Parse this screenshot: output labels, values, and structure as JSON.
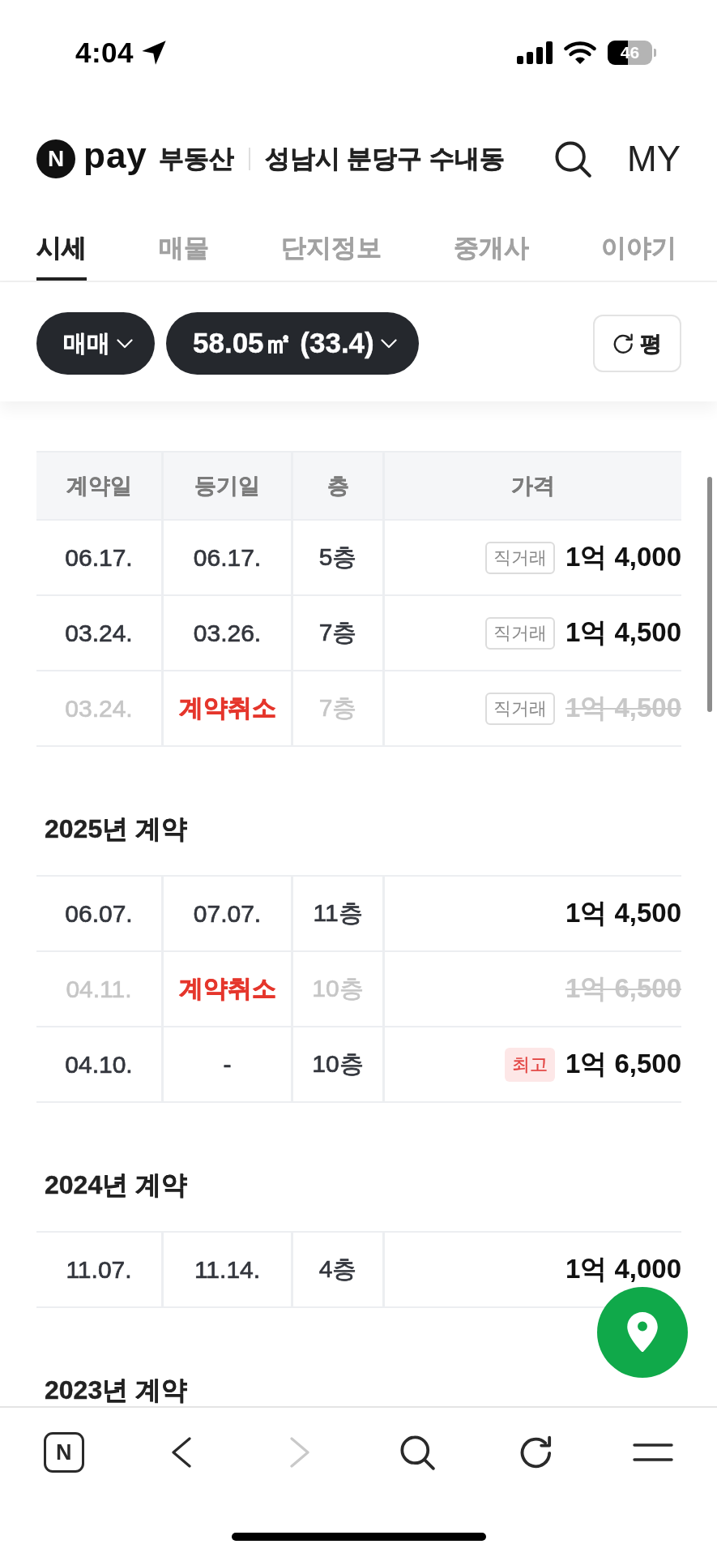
{
  "status_bar": {
    "time": "4:04",
    "battery": "46"
  },
  "header": {
    "logo": {
      "mark": "N",
      "text": "pay"
    },
    "service": "부동산",
    "location": "성남시 분당구 수내동",
    "my_button": "MY"
  },
  "tabs": [
    {
      "label": "시세",
      "selected": true
    },
    {
      "label": "매물",
      "selected": false
    },
    {
      "label": "단지정보",
      "selected": false
    },
    {
      "label": "중개사",
      "selected": false
    },
    {
      "label": "이야기",
      "selected": false
    }
  ],
  "filters": {
    "deal_type": "매매",
    "area": "58.05㎡ (33.4)",
    "unit_button": "평"
  },
  "sections": [
    {
      "columns": [
        "계약일",
        "등기일",
        "층",
        "가격"
      ],
      "rows": [
        {
          "contract_date": "06.17.",
          "registration_date": "06.17.",
          "floor": "5층",
          "tag": {
            "kind": "direct",
            "text": "직거래"
          },
          "price": "1억 4,000",
          "cancelled": false
        },
        {
          "contract_date": "03.24.",
          "registration_date": "03.26.",
          "floor": "7층",
          "tag": {
            "kind": "direct",
            "text": "직거래"
          },
          "price": "1억 4,500",
          "cancelled": false
        },
        {
          "contract_date": "03.24.",
          "registration_date": "계약취소",
          "floor": "7층",
          "tag": {
            "kind": "direct",
            "text": "직거래"
          },
          "price": "1억 4,500",
          "cancelled": true
        }
      ]
    },
    {
      "title": "2025년 계약",
      "rows": [
        {
          "contract_date": "06.07.",
          "registration_date": "07.07.",
          "floor": "11층",
          "price": "1억 4,500",
          "cancelled": false
        },
        {
          "contract_date": "04.11.",
          "registration_date": "계약취소",
          "floor": "10층",
          "price": "1억 6,500",
          "cancelled": true
        },
        {
          "contract_date": "04.10.",
          "registration_date": "-",
          "floor": "10층",
          "tag": {
            "kind": "highest",
            "text": "최고"
          },
          "price": "1억 6,500",
          "cancelled": false
        }
      ]
    },
    {
      "title": "2024년 계약",
      "rows": [
        {
          "contract_date": "11.07.",
          "registration_date": "11.14.",
          "floor": "4층",
          "price": "1억 4,000",
          "cancelled": false
        }
      ]
    },
    {
      "title": "2023년 계약"
    }
  ],
  "toolbar": [
    {
      "kind": "home",
      "label": "N",
      "disabled": false
    },
    {
      "kind": "back",
      "disabled": false
    },
    {
      "kind": "forward",
      "disabled": true
    },
    {
      "kind": "search",
      "disabled": false
    },
    {
      "kind": "refresh",
      "disabled": false
    },
    {
      "kind": "menu",
      "disabled": false
    }
  ]
}
